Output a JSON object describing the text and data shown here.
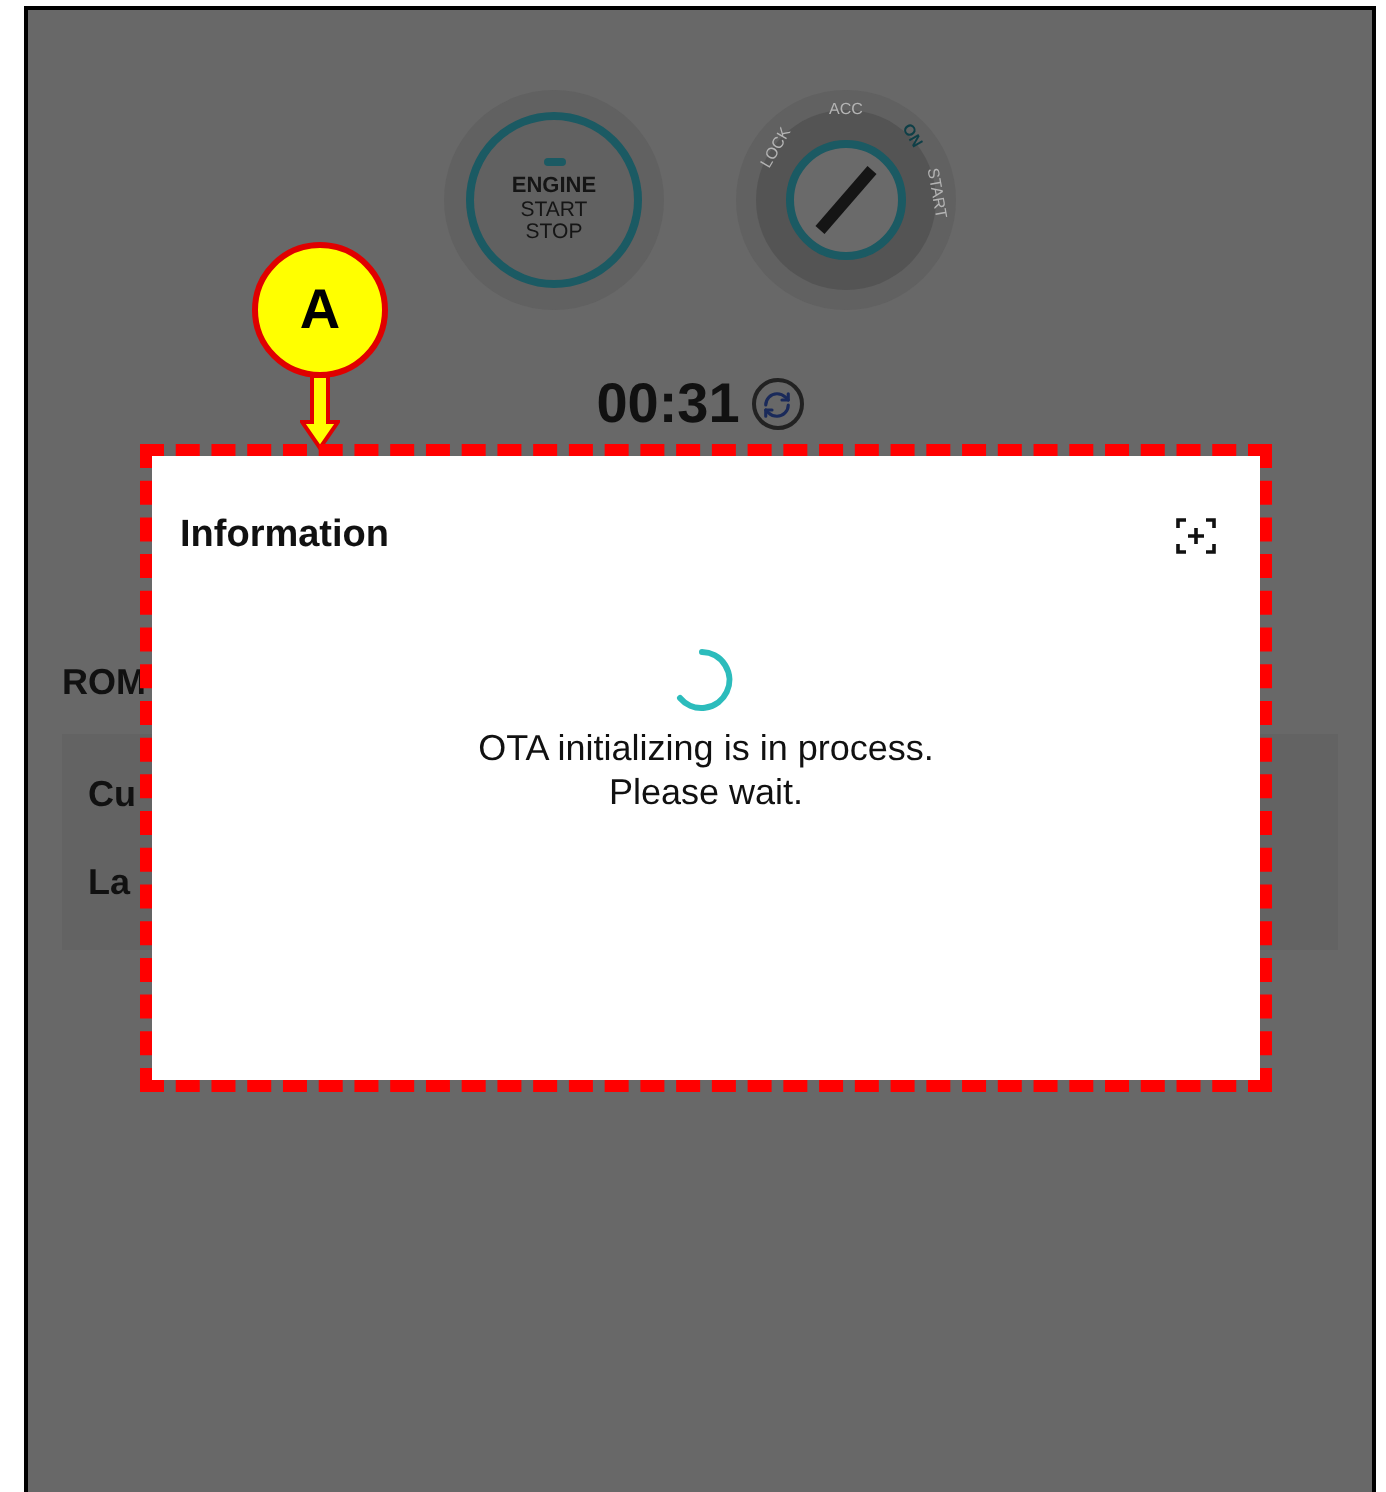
{
  "engine_button": {
    "title": "ENGINE",
    "lines": [
      "START",
      "STOP"
    ]
  },
  "ignition_key": {
    "positions": [
      {
        "label": "LOCK",
        "selected": false
      },
      {
        "label": "ACC",
        "selected": false
      },
      {
        "label": "ON",
        "selected": true
      },
      {
        "label": "START",
        "selected": false
      }
    ]
  },
  "timer": "00:31",
  "section": {
    "title": "ROM",
    "rows": [
      "Cu",
      "La"
    ]
  },
  "callout": {
    "label": "A"
  },
  "dialog": {
    "title": "Information",
    "message": "OTA initializing is in process.\nPlease wait."
  }
}
